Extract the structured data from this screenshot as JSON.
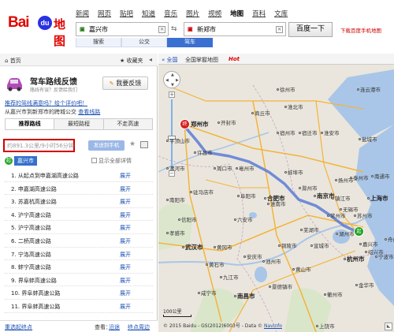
{
  "header": {
    "logo_left": "Bai",
    "logo_mid": "du",
    "logo_right": "地图",
    "nav": [
      "新闻",
      "网页",
      "贴吧",
      "知道",
      "音乐",
      "图片",
      "视频",
      "地图",
      "百科",
      "文库"
    ],
    "nav_active_index": 7,
    "from_value": "嘉兴市",
    "to_value": "新郑市",
    "search_button": "百度一下",
    "download_link": "下载百度手机地图",
    "modes": [
      "搜索",
      "公交",
      "驾车"
    ],
    "mode_active_index": 2
  },
  "left_panel": {
    "home": "首页",
    "favorites": "收藏夹",
    "feedback_title": "驾车路线反馈",
    "feedback_subtitle": "路线有误？反馈给我们",
    "feedback_button": "我要反馈",
    "recommend_link": "推荐的驾线满意吗？给个评价吧！",
    "via_text": "从嘉兴市到新郑市的跨城公交",
    "via_link": "查看线路",
    "route_tabs": [
      "推荐路线",
      "最短路程",
      "不走高速"
    ],
    "route_tab_active_index": 0,
    "distance": "约891.3公里/9小时56分钟",
    "send_button": "发送到手机",
    "start_badge": "起",
    "start_city": "嘉兴市",
    "show_all": "显示全部详情",
    "steps": [
      {
        "text": "1. 从起点到申嘉湖高速公路",
        "action": "展开"
      },
      {
        "text": "2. 申嘉湖高速公路",
        "action": "展开"
      },
      {
        "text": "3. 苏嘉杭高速公路",
        "action": "展开"
      },
      {
        "text": "4. 沪宁高速公路",
        "action": "展开"
      },
      {
        "text": "5. 沪宁高速公路",
        "action": "展开"
      },
      {
        "text": "6. 二桥高速公路",
        "action": "展开"
      },
      {
        "text": "7. 宁洛高速公路",
        "action": "展开"
      },
      {
        "text": "8. 蚌宁高速公路",
        "action": "展开"
      },
      {
        "text": "9. 界阜蚌高速公路",
        "action": "展开"
      },
      {
        "text": "10. 界阜蚌高速公路",
        "action": "展开"
      },
      {
        "text": "11. 界阜蚌高速公路",
        "action": "展开"
      }
    ],
    "footer_reset": "重选起终点",
    "footer_see": "查看：",
    "footer_nearby": "沿途",
    "footer_around": "终点周边"
  },
  "map": {
    "back": "全国",
    "dropdown": "全国掌握地图",
    "hot": "Hot",
    "zoom_plus": "+",
    "zoom_minus": "−",
    "pin_end": "终",
    "pin_start": "起",
    "scale": "100公里",
    "copyright": "© 2015 Baidu - GS(2012)6003号 - Data ©",
    "copyright_link": "Navinfo",
    "cities": [
      {
        "name": "郑州市",
        "big": true
      },
      {
        "name": "开封市",
        "big": false
      },
      {
        "name": "商丘市",
        "big": false
      },
      {
        "name": "许昌市",
        "big": false
      },
      {
        "name": "周口市",
        "big": false
      },
      {
        "name": "驻马店市",
        "big": false
      },
      {
        "name": "信阳市",
        "big": false
      },
      {
        "name": "阜阳市",
        "big": false
      },
      {
        "name": "亳州市",
        "big": false
      },
      {
        "name": "淮北市",
        "big": false
      },
      {
        "name": "宿州市",
        "big": false
      },
      {
        "name": "蚌埠市",
        "big": false
      },
      {
        "name": "淮南市",
        "big": false
      },
      {
        "name": "滁州市",
        "big": false
      },
      {
        "name": "合肥市",
        "big": true
      },
      {
        "name": "六安市",
        "big": false
      },
      {
        "name": "安庆市",
        "big": false
      },
      {
        "name": "芜湖市",
        "big": false
      },
      {
        "name": "南京市",
        "big": true
      },
      {
        "name": "扬州市",
        "big": false
      },
      {
        "name": "泰州市",
        "big": false
      },
      {
        "name": "南通市",
        "big": false
      },
      {
        "name": "无锡市",
        "big": false
      },
      {
        "name": "苏州市",
        "big": false
      },
      {
        "name": "上海市",
        "big": true
      },
      {
        "name": "嘉兴市",
        "big": false
      },
      {
        "name": "湖州市",
        "big": false
      },
      {
        "name": "杭州市",
        "big": true
      },
      {
        "name": "宁波市",
        "big": false
      },
      {
        "name": "绍兴市",
        "big": false
      },
      {
        "name": "武汉市",
        "big": true
      },
      {
        "name": "黄石市",
        "big": false
      },
      {
        "name": "九江市",
        "big": false
      },
      {
        "name": "南昌市",
        "big": true
      },
      {
        "name": "景德镇市",
        "big": false
      },
      {
        "name": "黄山市",
        "big": false
      },
      {
        "name": "衢州市",
        "big": false
      },
      {
        "name": "金华市",
        "big": false
      },
      {
        "name": "连云港市",
        "big": false
      },
      {
        "name": "徐州市",
        "big": false
      },
      {
        "name": "宿迁市",
        "big": false
      },
      {
        "name": "淮安市",
        "big": false
      },
      {
        "name": "盐城市",
        "big": false
      },
      {
        "name": "镇江市",
        "big": false
      },
      {
        "name": "常州市",
        "big": false
      },
      {
        "name": "宣城市",
        "big": false
      },
      {
        "name": "铜陵市",
        "big": false
      },
      {
        "name": "池州市",
        "big": false
      },
      {
        "name": "孝感市",
        "big": false
      },
      {
        "name": "黄冈市",
        "big": false
      },
      {
        "name": "咸宁市",
        "big": false
      },
      {
        "name": "平顶山市",
        "big": false
      },
      {
        "name": "漯河市",
        "big": false
      },
      {
        "name": "南阳市",
        "big": false
      },
      {
        "name": "舟山市",
        "big": false
      },
      {
        "name": "上饶市",
        "big": false
      }
    ]
  },
  "colors": {
    "route": "#5a7ad6",
    "highway": "#f3b43a",
    "water": "#a9c6e8",
    "land": "#eae6dd",
    "brand_red": "#e10602",
    "brand_blue": "#2932e1"
  }
}
